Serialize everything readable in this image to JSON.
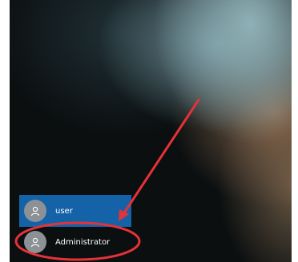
{
  "users": [
    {
      "name": "user",
      "selected": true
    },
    {
      "name": "Administrator",
      "selected": false
    }
  ],
  "annotation": {
    "color": "#e53238"
  },
  "icons": {
    "avatar": "person-icon"
  }
}
